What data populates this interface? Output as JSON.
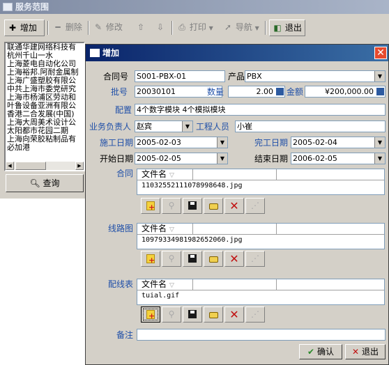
{
  "back_window": {
    "title": "服务范围",
    "toolbar": {
      "add": "增加",
      "delete": "删除",
      "edit": "修改",
      "print": "打印",
      "nav": "导航",
      "exit": "退出"
    },
    "list_items": [
      "联通华建网络科技有",
      "杭州千山一水",
      "上海菱电自动化公司",
      "上海裕邦.阿耐金属制",
      "上海广盛塑胶有限公",
      "中共上海市委党研究",
      "上海市杨浦区劳动和",
      "叶鲁设备亚洲有限公",
      "香港二合发展(中国)",
      "上海大周美术设计公",
      "太阳都市花园二期",
      "上海向荣胶粘制品有",
      "必加港"
    ],
    "query_button": "查询"
  },
  "dialog": {
    "title": "增加",
    "contract_no_label": "合同号",
    "contract_no": "S001-PBX-01",
    "product_label": "产品",
    "product": "PBX",
    "batch_label": "批号",
    "batch": "20030101",
    "qty_label": "数量",
    "qty": "2.00",
    "amount_label": "金额",
    "amount": "¥200,000.00",
    "config_label": "配置",
    "config": "4个数字模块 4个模拟模块",
    "manager_label": "业务负责人",
    "manager": "赵宾",
    "engineer_label": "工程人员",
    "engineer": "小崔",
    "start_work_label": "施工日期",
    "start_work": "2005-02-03",
    "finish_label": "完工日期",
    "finish": "2005-02-04",
    "begin_label": "开始日期",
    "begin": "2005-02-05",
    "end_label": "结束日期",
    "end": "2006-02-05",
    "file_col": "文件名",
    "sections": [
      {
        "label": "合同",
        "file": "11032552111078998648.jpg"
      },
      {
        "label": "线路图",
        "file": "10979334981982652060.jpg"
      },
      {
        "label": "配线表",
        "file": "tuial.gif"
      }
    ],
    "remark_label": "备注",
    "remark": "",
    "ok": "确认",
    "cancel": "退出"
  }
}
